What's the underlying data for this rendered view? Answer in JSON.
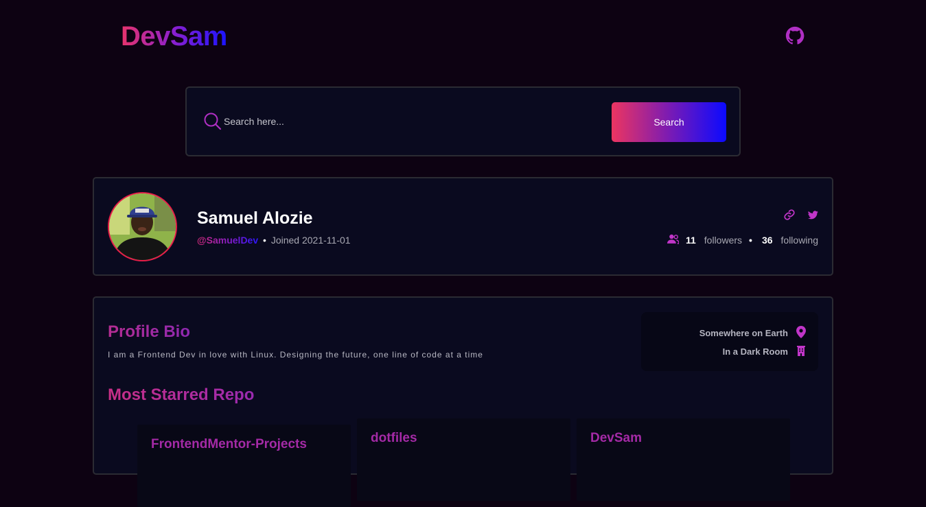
{
  "header": {
    "logo": "DevSam",
    "github_icon": "github-icon"
  },
  "search": {
    "placeholder": "Search here...",
    "button_label": "Search",
    "icon": "search-icon"
  },
  "profile": {
    "name": "Samuel Alozie",
    "handle": "@SamuelDev",
    "separator": "•",
    "joined": "Joined 2021-11-01",
    "avatar_icon": "avatar",
    "link_icon": "link-icon",
    "twitter_icon": "twitter-icon",
    "followers_icon": "users-icon",
    "followers_count": "11",
    "followers_label": "followers",
    "stats_separator": "•",
    "following_count": "36",
    "following_label": "following"
  },
  "bio": {
    "title": "Profile Bio",
    "text": "I am a Frontend Dev in love with Linux. Designing the future, one line of code at a time",
    "location": "Somewhere on Earth",
    "location_icon": "map-pin-icon",
    "company": "In a Dark Room",
    "company_icon": "building-icon"
  },
  "repos": {
    "title": "Most Starred Repo",
    "items": [
      {
        "name": "FrontendMentor-Projects"
      },
      {
        "name": "dotfiles"
      },
      {
        "name": "DevSam"
      }
    ]
  },
  "colors": {
    "background": "#0d0212",
    "card": "#0a0a1f",
    "accent_pink": "#e8336b",
    "accent_blue": "#1a14ff",
    "accent_purple": "#b52d92"
  }
}
